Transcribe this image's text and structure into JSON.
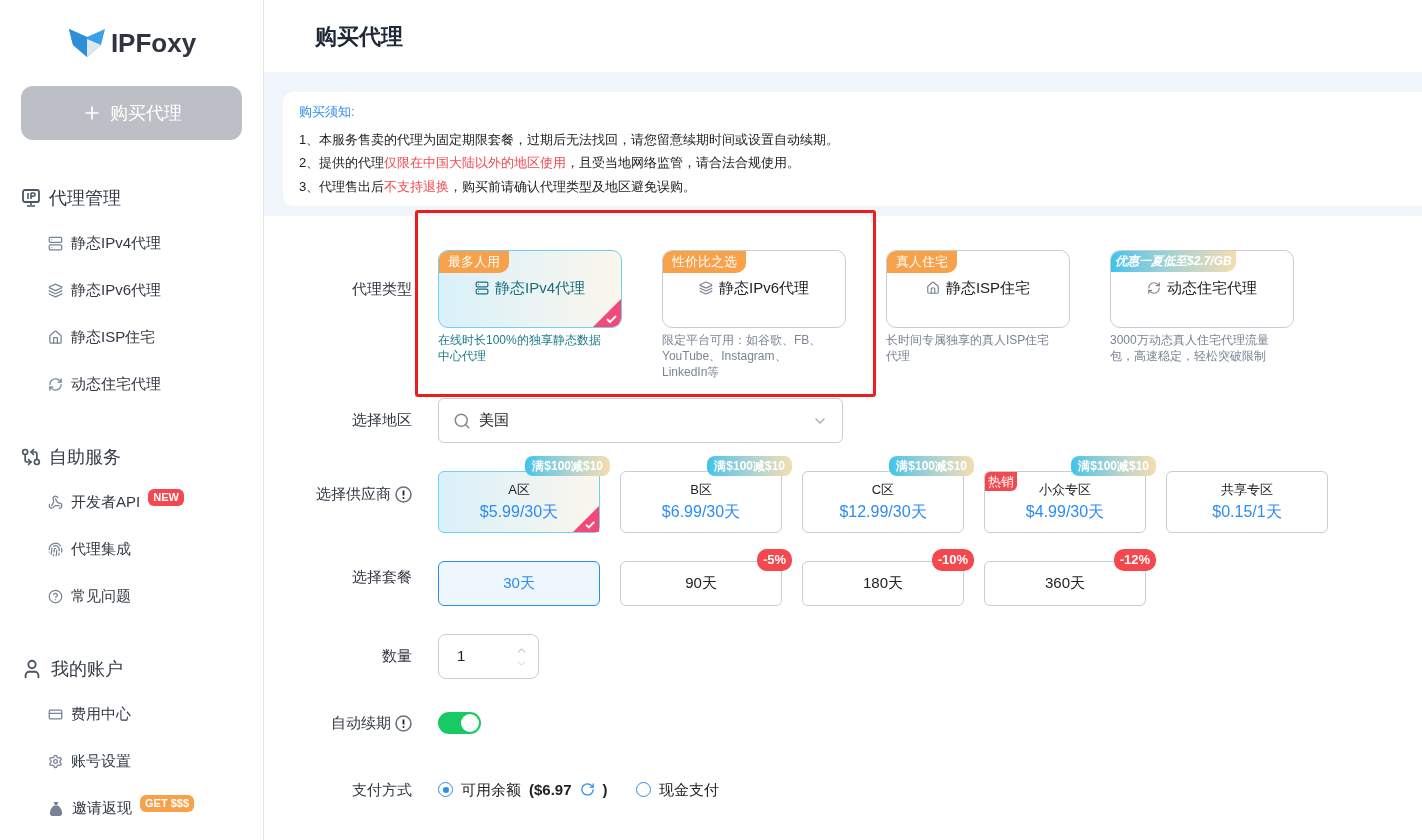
{
  "sidebar": {
    "logo": "IPFoxy",
    "buy_button": "购买代理",
    "sections": [
      {
        "title": "代理管理",
        "items": [
          {
            "label": "静态IPv4代理"
          },
          {
            "label": "静态IPv6代理"
          },
          {
            "label": "静态ISP住宅"
          },
          {
            "label": "动态住宅代理"
          }
        ]
      },
      {
        "title": "自助服务",
        "items": [
          {
            "label": "开发者API",
            "badge": {
              "text": "NEW",
              "color": "#f5484e"
            }
          },
          {
            "label": "代理集成"
          },
          {
            "label": "常见问题"
          }
        ]
      },
      {
        "title": "我的账户",
        "items": [
          {
            "label": "费用中心"
          },
          {
            "label": "账号设置"
          },
          {
            "label": "邀请返现",
            "badge": {
              "text": "GET $$$",
              "color": "#f7a14a"
            }
          }
        ]
      }
    ]
  },
  "header": {
    "title": "购买代理"
  },
  "notice": {
    "title": "购买须知:",
    "lines": [
      [
        {
          "text": "1、本服务售卖的代理为固定期限套餐，过期后无法找回，请您留意续期时间或设置自动续期。",
          "highlight": false
        }
      ],
      [
        {
          "text": "2、提供的代理",
          "highlight": false
        },
        {
          "text": "仅限在中国大陆以外的地区使用",
          "highlight": true
        },
        {
          "text": "，且受当地网络监管，请合法合规使用。",
          "highlight": false
        }
      ],
      [
        {
          "text": "3、代理售出后",
          "highlight": false
        },
        {
          "text": "不支持退换",
          "highlight": true
        },
        {
          "text": "，购买前请确认代理类型及地区避免误购。",
          "highlight": false
        }
      ]
    ]
  },
  "proxy_type": {
    "label": "代理类型",
    "options": [
      {
        "tag": {
          "text": "最多人用",
          "kind": "plain"
        },
        "name": "静态IPv4代理",
        "description": "在线时长100%的独享静态数据中心代理",
        "selected": true
      },
      {
        "tag": {
          "text": "性价比之选",
          "kind": "plain"
        },
        "name": "静态IPv6代理",
        "description": "限定平台可用：如谷歌、FB、YouTube、Instagram、LinkedIn等",
        "selected": false
      },
      {
        "tag": {
          "text": "真人住宅",
          "kind": "plain"
        },
        "name": "静态ISP住宅",
        "description": "长时间专属独享的真人ISP住宅代理",
        "selected": false
      },
      {
        "tag": {
          "text": "优惠一夏低至$2.7/GB",
          "kind": "promo"
        },
        "name": "动态住宅代理",
        "description": "3000万动态真人住宅代理流量包，高速稳定，轻松突破限制",
        "selected": false
      }
    ]
  },
  "region": {
    "label": "选择地区",
    "value": "美国"
  },
  "supplier": {
    "label": "选择供应商",
    "options": [
      {
        "name": "A区",
        "price": "$5.99/30天",
        "promo": "满$100减$10",
        "selected": true
      },
      {
        "name": "B区",
        "price": "$6.99/30天",
        "promo": "满$100减$10",
        "selected": false
      },
      {
        "name": "C区",
        "price": "$12.99/30天",
        "promo": "满$100减$10",
        "selected": false
      },
      {
        "name": "小众专区",
        "price": "$4.99/30天",
        "promo": "满$100减$10",
        "hot": "热销",
        "selected": false
      },
      {
        "name": "共享专区",
        "price": "$0.15/1天",
        "selected": false
      }
    ]
  },
  "plan": {
    "label": "选择套餐",
    "options": [
      {
        "label": "30天",
        "selected": true
      },
      {
        "label": "90天",
        "discount": "-5%",
        "selected": false
      },
      {
        "label": "180天",
        "discount": "-10%",
        "selected": false
      },
      {
        "label": "360天",
        "discount": "-12%",
        "selected": false
      }
    ]
  },
  "quantity": {
    "label": "数量",
    "value": "1"
  },
  "auto_renew": {
    "label": "自动续期",
    "on": true
  },
  "payment": {
    "label": "支付方式",
    "options": [
      {
        "label": "可用余额",
        "amount": "($6.97",
        "closing": ")",
        "selected": true
      },
      {
        "label": "现金支付",
        "selected": false
      }
    ]
  }
}
